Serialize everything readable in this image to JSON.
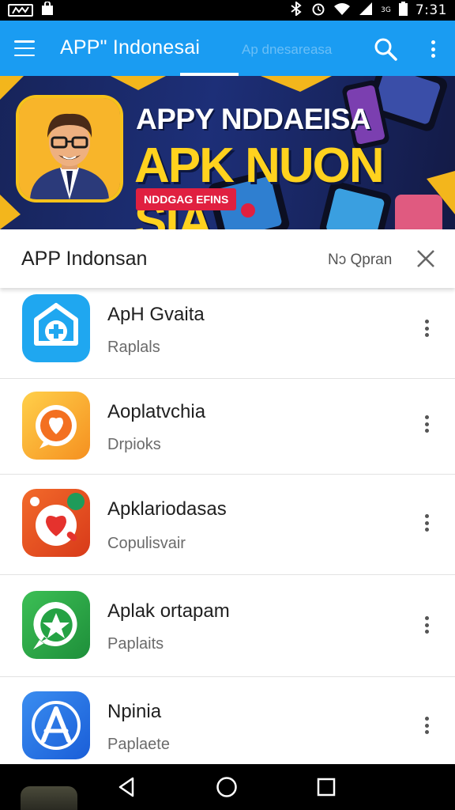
{
  "status_bar": {
    "time": "7:31",
    "extra_label": "3G",
    "colors": {
      "background": "#000000",
      "foreground": "#ffffff"
    }
  },
  "app_bar": {
    "title": "APPʺ Indonesai",
    "ghost_tab": "Ap dnesareasa",
    "icons": [
      "menu-icon",
      "search-icon",
      "more-vert-icon"
    ],
    "color": "#1a9cf2"
  },
  "banner": {
    "line1": "APPY NDDAEISA",
    "line2": "APK NUON SIA",
    "badge": "NDDGAG EFINS",
    "colors": {
      "headline": "#ffd21e",
      "badge": "#e02040",
      "background": "#1d2f78"
    }
  },
  "section": {
    "title": "APP Indonsan",
    "action": "Nɔ Qpran",
    "close_icon": "close-icon"
  },
  "apps": [
    {
      "name": "ApH Gvaita",
      "subtitle": "Raplals",
      "icon": "shield-plus-icon"
    },
    {
      "name": "Aoplatvchia",
      "subtitle": "Drpioks",
      "icon": "chat-heart-icon"
    },
    {
      "name": "Apklariodasas",
      "subtitle": "Copulisvair",
      "icon": "heart-phone-icon"
    },
    {
      "name": "Aplak ortapam",
      "subtitle": "Paplaits",
      "icon": "whatsapp-star-icon"
    },
    {
      "name": "Npinia",
      "subtitle": "Paplaete",
      "icon": "app-store-icon"
    }
  ],
  "nav_bar": {
    "icons": [
      "back-icon",
      "home-icon",
      "recents-icon"
    ]
  }
}
